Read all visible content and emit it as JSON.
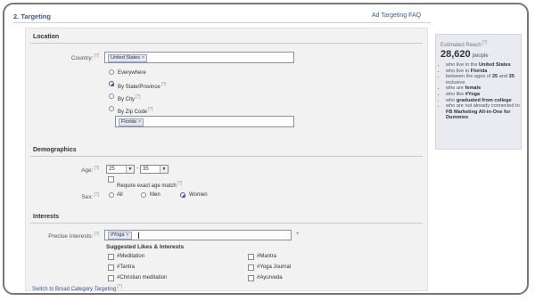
{
  "header": {
    "section_title": "2. Targeting",
    "faq_link": "Ad Targeting FAQ"
  },
  "help_marker": "[?]",
  "location": {
    "heading": "Location",
    "country_label": "Country:",
    "country_token": "United States",
    "remove_glyph": "×",
    "options": [
      "Everywhere",
      "By State/Province",
      "By City",
      "By Zip Code"
    ],
    "selected_option": "By State/Province",
    "state_token": "Florida"
  },
  "demographics": {
    "heading": "Demographics",
    "age_label": "Age:",
    "age_min": "25",
    "age_dash": "-",
    "age_max": "35",
    "exact_age_label": "Require exact age match",
    "sex_label": "Sex:",
    "sex_options": [
      "All",
      "Men",
      "Women"
    ],
    "sex_selected": "Women"
  },
  "interests": {
    "heading": "Interests",
    "precise_label": "Precise Interests:",
    "interest_token": "#Yoga",
    "add_glyph": "+",
    "suggested_heading": "Suggested Likes & Interests",
    "suggested_left": [
      "#Meditation",
      "#Tantra",
      "#Christian meditation"
    ],
    "suggested_right": [
      "#Mantra",
      "#Yoga Journal",
      "#Ayurveda"
    ],
    "switch_link": "Switch to Broad Category Targeting"
  },
  "estimate": {
    "label": "Estimated Reach",
    "count": "28,620",
    "unit": "people",
    "bullets": [
      {
        "pre": "who live in the ",
        "bold": "United States",
        "post": ""
      },
      {
        "pre": "who live in ",
        "bold": "Florida",
        "post": ""
      },
      {
        "pre": "between the ages of ",
        "bold": "25",
        "post": " and ",
        "bold2": "35",
        "post2": " inclusive"
      },
      {
        "pre": "who are ",
        "bold": "female",
        "post": ""
      },
      {
        "pre": "who like ",
        "bold": "#Yoga",
        "post": ""
      },
      {
        "pre": "who ",
        "bold": "graduated from college",
        "post": ""
      },
      {
        "pre": "who are not already connected to ",
        "bold": "FB Marketing All-in-One for Dummies",
        "post": ""
      }
    ]
  },
  "colors": {
    "accent": "#3b5998",
    "panel_bg": "#f2f2f2",
    "sidebar_bg": "#e9ebf0"
  }
}
